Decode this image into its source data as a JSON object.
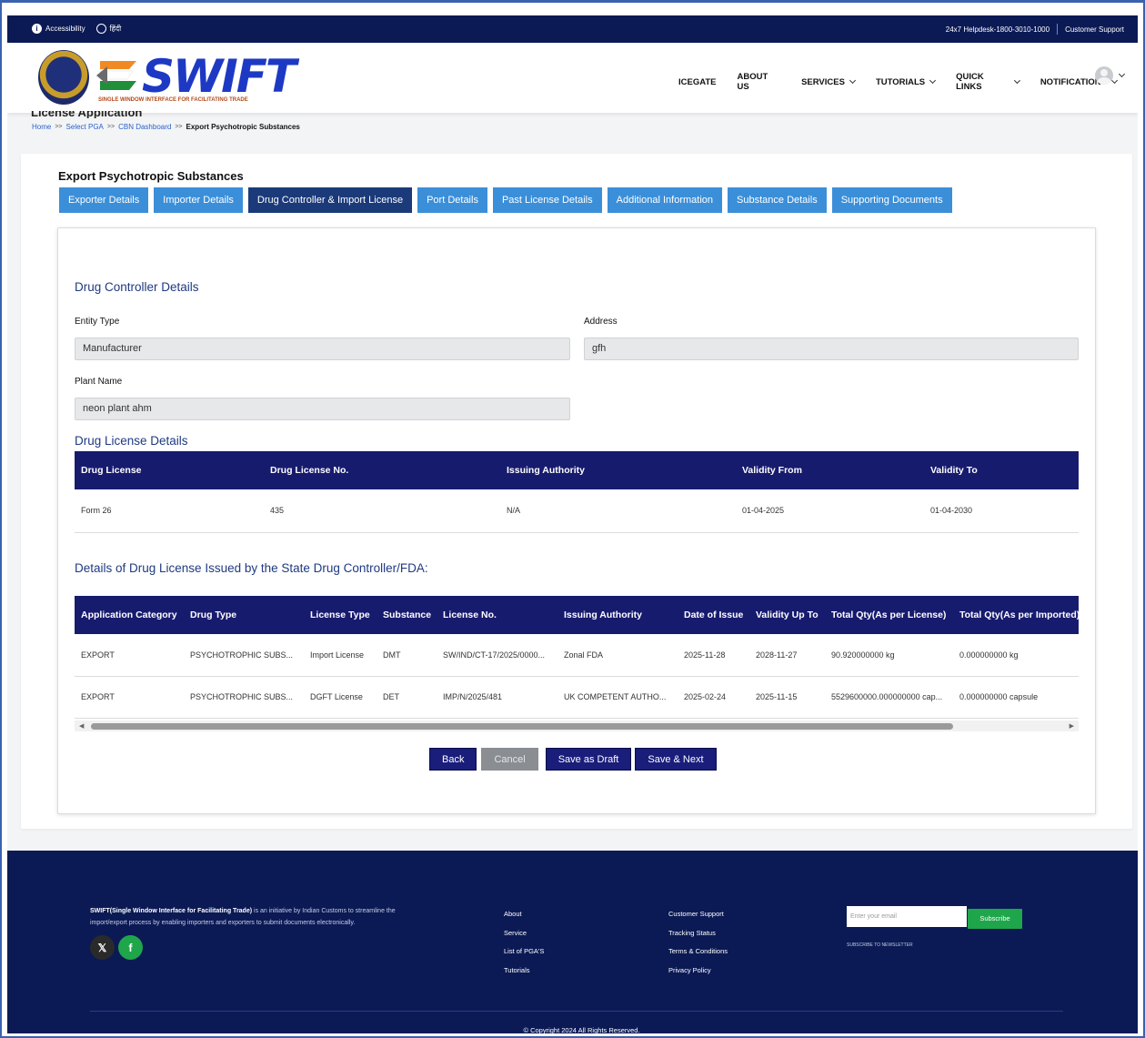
{
  "topbar": {
    "accessibility": "Accessibility",
    "language": "हिंदी",
    "helpdesk": "24x7 Helpdesk-1800-3010-1000",
    "support": "Customer Support"
  },
  "logo": {
    "title": "SWIFT",
    "subtitle": "SINGLE WINDOW INTERFACE FOR FACILITATING TRADE"
  },
  "nav": {
    "icegate": "ICEGATE",
    "about": "ABOUT US",
    "services": "SERVICES",
    "tutorials": "TUTORIALS",
    "quicklinks": "QUICK LINKS",
    "notifications": "NOTIFICATIONS"
  },
  "page": {
    "heading_partial": "License Application"
  },
  "breadcrumb": {
    "home": "Home",
    "sep": ">>",
    "select_pga": "Select PGA",
    "cbn": "CBN Dashboard",
    "current": "Export Psychotropic Substances"
  },
  "card": {
    "title": "Export Psychotropic Substances"
  },
  "tabs": [
    {
      "label": "Exporter Details"
    },
    {
      "label": "Importer Details"
    },
    {
      "label": "Drug Controller & Import License"
    },
    {
      "label": "Port Details"
    },
    {
      "label": "Past License Details"
    },
    {
      "label": "Additional Information"
    },
    {
      "label": "Substance Details"
    },
    {
      "label": "Supporting Documents"
    }
  ],
  "drug_controller": {
    "title": "Drug Controller Details",
    "entity_type_label": "Entity Type",
    "entity_type_value": "Manufacturer",
    "address_label": "Address",
    "address_value": "gfh",
    "plant_name_label": "Plant Name",
    "plant_name_value": "neon plant ahm"
  },
  "drug_license": {
    "title": "Drug License Details",
    "headers": [
      "Drug License",
      "Drug License No.",
      "Issuing Authority",
      "Validity From",
      "Validity To"
    ],
    "rows": [
      [
        "Form 26",
        "435",
        "N/A",
        "01-04-2025",
        "01-04-2030"
      ]
    ]
  },
  "state_license": {
    "title": "Details of Drug License Issued by the State Drug Controller/FDA:",
    "headers": [
      "Application Category",
      "Drug Type",
      "License Type",
      "Substance",
      "License No.",
      "Issuing Authority",
      "Date of Issue",
      "Validity Up To",
      "Total Qty(As per License)",
      "Total Qty(As per Imported)"
    ],
    "rows": [
      [
        "EXPORT",
        "PSYCHOTROPHIC SUBS...",
        "Import License",
        "DMT",
        "SW/IND/CT-17/2025/0000...",
        "Zonal FDA",
        "2025-11-28",
        "2028-11-27",
        "90.920000000 kg",
        "0.000000000 kg"
      ],
      [
        "EXPORT",
        "PSYCHOTROPHIC SUBS...",
        "DGFT License",
        "DET",
        "IMP/N/2025/481",
        "UK COMPETENT AUTHO...",
        "2025-02-24",
        "2025-11-15",
        "5529600000.000000000 cap...",
        "0.000000000 capsule"
      ]
    ]
  },
  "buttons": {
    "back": "Back",
    "cancel": "Cancel",
    "save_draft": "Save as Draft",
    "save_next": "Save & Next"
  },
  "footer": {
    "desc_bold": "SWIFT(Single Window Interface for Facilitating Trade)",
    "desc_rest": " is an initiative by Indian Customs to streamline the import/export process by enabling importers and exporters to submit documents electronically.",
    "col1": [
      "About",
      "Service",
      "List of PGA'S",
      "Tutorials"
    ],
    "col2": [
      "Customer Support",
      "Tracking Status",
      "Terms & Conditions",
      "Privacy Policy"
    ],
    "email_placeholder": "Enter your email",
    "subscribe": "Subscribe",
    "newsletter": "SUBSCRIBE TO NEWSLETTER",
    "copyright": "© Copyright 2024 All Rights Reserved."
  },
  "colors": {
    "navy": "#0b1a55",
    "tab_blue": "#3b8fd9",
    "tab_active": "#1b3a7a",
    "table_head": "#171b6e",
    "green": "#1fa64b"
  }
}
